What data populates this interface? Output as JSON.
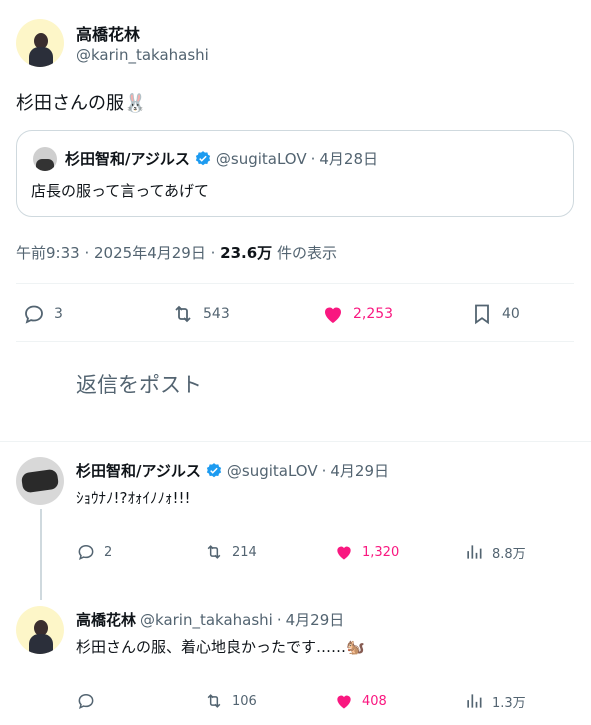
{
  "main_tweet": {
    "display_name": "高橋花林",
    "handle": "@karin_takahashi",
    "text": "杉田さんの服🐰",
    "quote": {
      "display_name": "杉田智和/アジルス",
      "handle": "@sugitaLOV",
      "date": "4月28日",
      "text": "店長の服って言ってあげて"
    },
    "meta": {
      "time": "午前9:33",
      "date": "2025年4月29日",
      "views": "23.6万",
      "views_label": "件の表示"
    },
    "stats": {
      "replies": "3",
      "retweets": "543",
      "likes": "2,253",
      "bookmarks": "40"
    }
  },
  "reply_composer": {
    "placeholder": "返信をポスト"
  },
  "replies": [
    {
      "display_name": "杉田智和/アジルス",
      "handle": "@sugitaLOV",
      "date": "4月29日",
      "text": "ｼｮｳﾅﾉ!?ｵｫｲﾉﾉｫ!!!",
      "stats": {
        "replies": "2",
        "retweets": "214",
        "likes": "1,320",
        "views": "8.8万"
      }
    },
    {
      "display_name": "高橋花林",
      "handle": "@karin_takahashi",
      "date": "4月29日",
      "text": "杉田さんの服、着心地良かったです……🐿️",
      "stats": {
        "replies": "",
        "retweets": "106",
        "likes": "408",
        "views": "1.3万"
      }
    }
  ],
  "colors": {
    "verified": "#1d9bf0",
    "like": "#f91880",
    "muted": "#536471",
    "divider": "#eff3f4"
  }
}
